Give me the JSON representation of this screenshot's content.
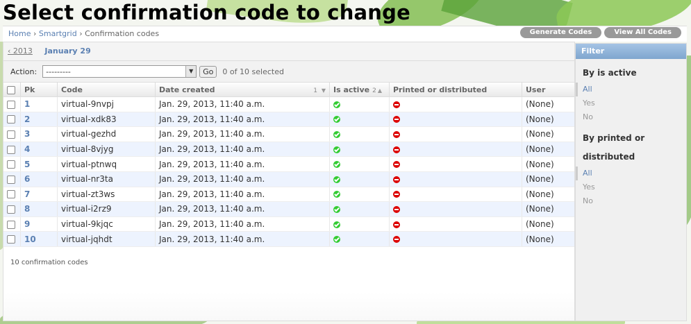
{
  "page": {
    "title": "Select confirmation code to change"
  },
  "breadcrumbs": {
    "home": "Home",
    "app": "Smartgrid",
    "current": "Confirmation codes",
    "sep": " › "
  },
  "tools": {
    "generate": "Generate Codes",
    "view_all": "View All Codes"
  },
  "date_hierarchy": {
    "prev": "‹ 2013",
    "current": "January 29"
  },
  "actions": {
    "label": "Action:",
    "selected": "---------",
    "go": "Go",
    "counter": "0 of 10 selected"
  },
  "table": {
    "headers": {
      "pk": "Pk",
      "code": "Code",
      "date_created": "Date created",
      "date_sort_num": "1",
      "is_active": "Is active",
      "is_active_sort_num": "2",
      "printed": "Printed or distributed",
      "user": "User"
    },
    "rows": [
      {
        "pk": "1",
        "code": "virtual-9nvpj",
        "date": "Jan. 29, 2013, 11:40 a.m.",
        "is_active": true,
        "printed": false,
        "user": "(None)"
      },
      {
        "pk": "2",
        "code": "virtual-xdk83",
        "date": "Jan. 29, 2013, 11:40 a.m.",
        "is_active": true,
        "printed": false,
        "user": "(None)"
      },
      {
        "pk": "3",
        "code": "virtual-gezhd",
        "date": "Jan. 29, 2013, 11:40 a.m.",
        "is_active": true,
        "printed": false,
        "user": "(None)"
      },
      {
        "pk": "4",
        "code": "virtual-8vjyg",
        "date": "Jan. 29, 2013, 11:40 a.m.",
        "is_active": true,
        "printed": false,
        "user": "(None)"
      },
      {
        "pk": "5",
        "code": "virtual-ptnwq",
        "date": "Jan. 29, 2013, 11:40 a.m.",
        "is_active": true,
        "printed": false,
        "user": "(None)"
      },
      {
        "pk": "6",
        "code": "virtual-nr3ta",
        "date": "Jan. 29, 2013, 11:40 a.m.",
        "is_active": true,
        "printed": false,
        "user": "(None)"
      },
      {
        "pk": "7",
        "code": "virtual-zt3ws",
        "date": "Jan. 29, 2013, 11:40 a.m.",
        "is_active": true,
        "printed": false,
        "user": "(None)"
      },
      {
        "pk": "8",
        "code": "virtual-i2rz9",
        "date": "Jan. 29, 2013, 11:40 a.m.",
        "is_active": true,
        "printed": false,
        "user": "(None)"
      },
      {
        "pk": "9",
        "code": "virtual-9kjqc",
        "date": "Jan. 29, 2013, 11:40 a.m.",
        "is_active": true,
        "printed": false,
        "user": "(None)"
      },
      {
        "pk": "10",
        "code": "virtual-jqhdt",
        "date": "Jan. 29, 2013, 11:40 a.m.",
        "is_active": true,
        "printed": false,
        "user": "(None)"
      }
    ]
  },
  "paginator": "10 confirmation codes",
  "filter": {
    "title": "Filter",
    "groups": [
      {
        "title": "By is active",
        "options": [
          {
            "label": "All",
            "selected": true
          },
          {
            "label": "Yes",
            "selected": false
          },
          {
            "label": "No",
            "selected": false
          }
        ]
      },
      {
        "title": "By printed or distributed",
        "options": [
          {
            "label": "All",
            "selected": true
          },
          {
            "label": "Yes",
            "selected": false
          },
          {
            "label": "No",
            "selected": false
          }
        ]
      }
    ]
  },
  "colors": {
    "link": "#5b80b2",
    "active_icon": "#33cc33",
    "inactive_icon": "#dd0000",
    "filter_header": "#7fa6cf"
  }
}
